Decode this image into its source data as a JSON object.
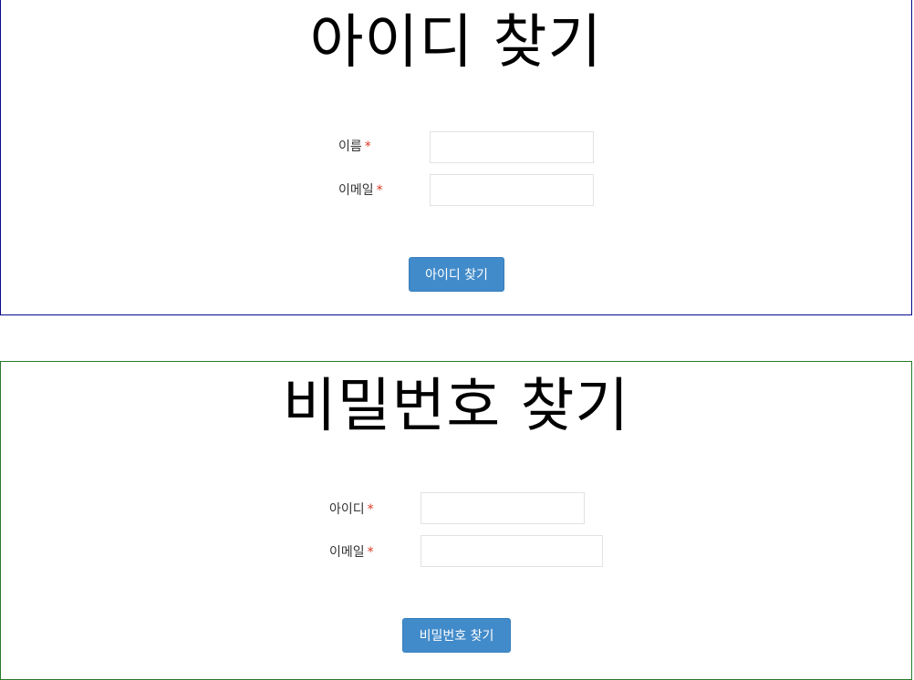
{
  "find_id": {
    "title": "아이디 찾기",
    "fields": [
      {
        "label": "이름",
        "required_mark": "*",
        "value": ""
      },
      {
        "label": "이메일",
        "required_mark": "*",
        "value": ""
      }
    ],
    "submit_label": "아이디 찾기",
    "border_color": "#0a0a8c"
  },
  "find_password": {
    "title": "비밀번호 찾기",
    "fields": [
      {
        "label": "아이디",
        "required_mark": "*",
        "value": ""
      },
      {
        "label": "이메일",
        "required_mark": "*",
        "value": ""
      }
    ],
    "submit_label": "비밀번호 찾기",
    "border_color": "#2a7a2a"
  },
  "colors": {
    "button": "#428bca",
    "required": "#d9381e"
  }
}
